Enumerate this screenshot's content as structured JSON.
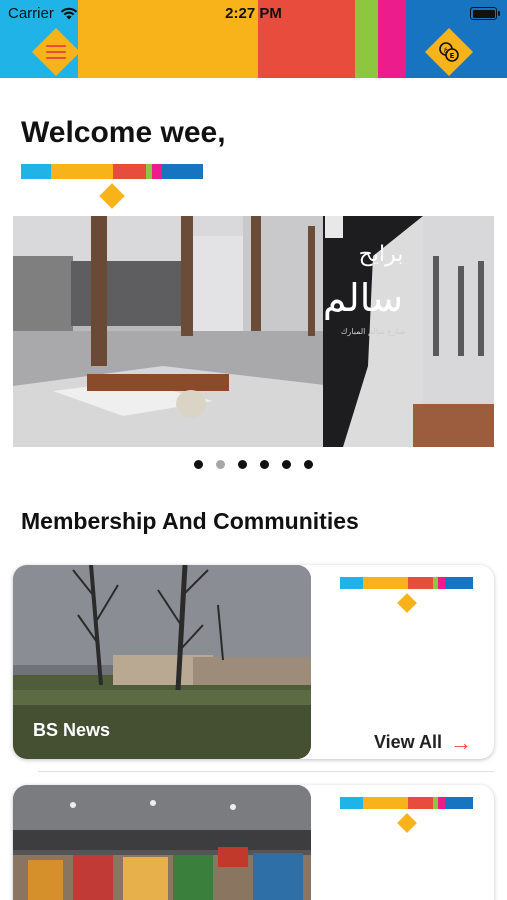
{
  "status_bar": {
    "carrier": "Carrier",
    "time": "2:27 PM"
  },
  "header": {
    "colors": [
      "#1fb3e8",
      "#f9b31a",
      "#e84c3d",
      "#8dc63f",
      "#ec1c8c",
      "#1674c0"
    ],
    "menu_icon": "hamburger-icon",
    "language_icon": "language-switch-icon",
    "language_glyph_1": "ع",
    "language_glyph_2": "E"
  },
  "welcome": {
    "text": "Welcome wee,"
  },
  "brand_stripe_colors": [
    "#1fb3e8",
    "#f9b31a",
    "#e84c3d",
    "#8dc63f",
    "#ec1c8c",
    "#1674c0"
  ],
  "banner": {
    "sign_text_1": "برايح",
    "sign_text_2": "سالم",
    "sign_subtext": "شارع سالم المبارك",
    "carousel": {
      "count": 6,
      "active_index": 1
    }
  },
  "sections": {
    "membership": {
      "title": "Membership And Communities",
      "cards": [
        {
          "label": "BS News",
          "link_label": "View All",
          "link_icon": "arrow-right-icon"
        },
        {
          "label": "",
          "link_label": "",
          "link_icon": ""
        }
      ]
    }
  }
}
